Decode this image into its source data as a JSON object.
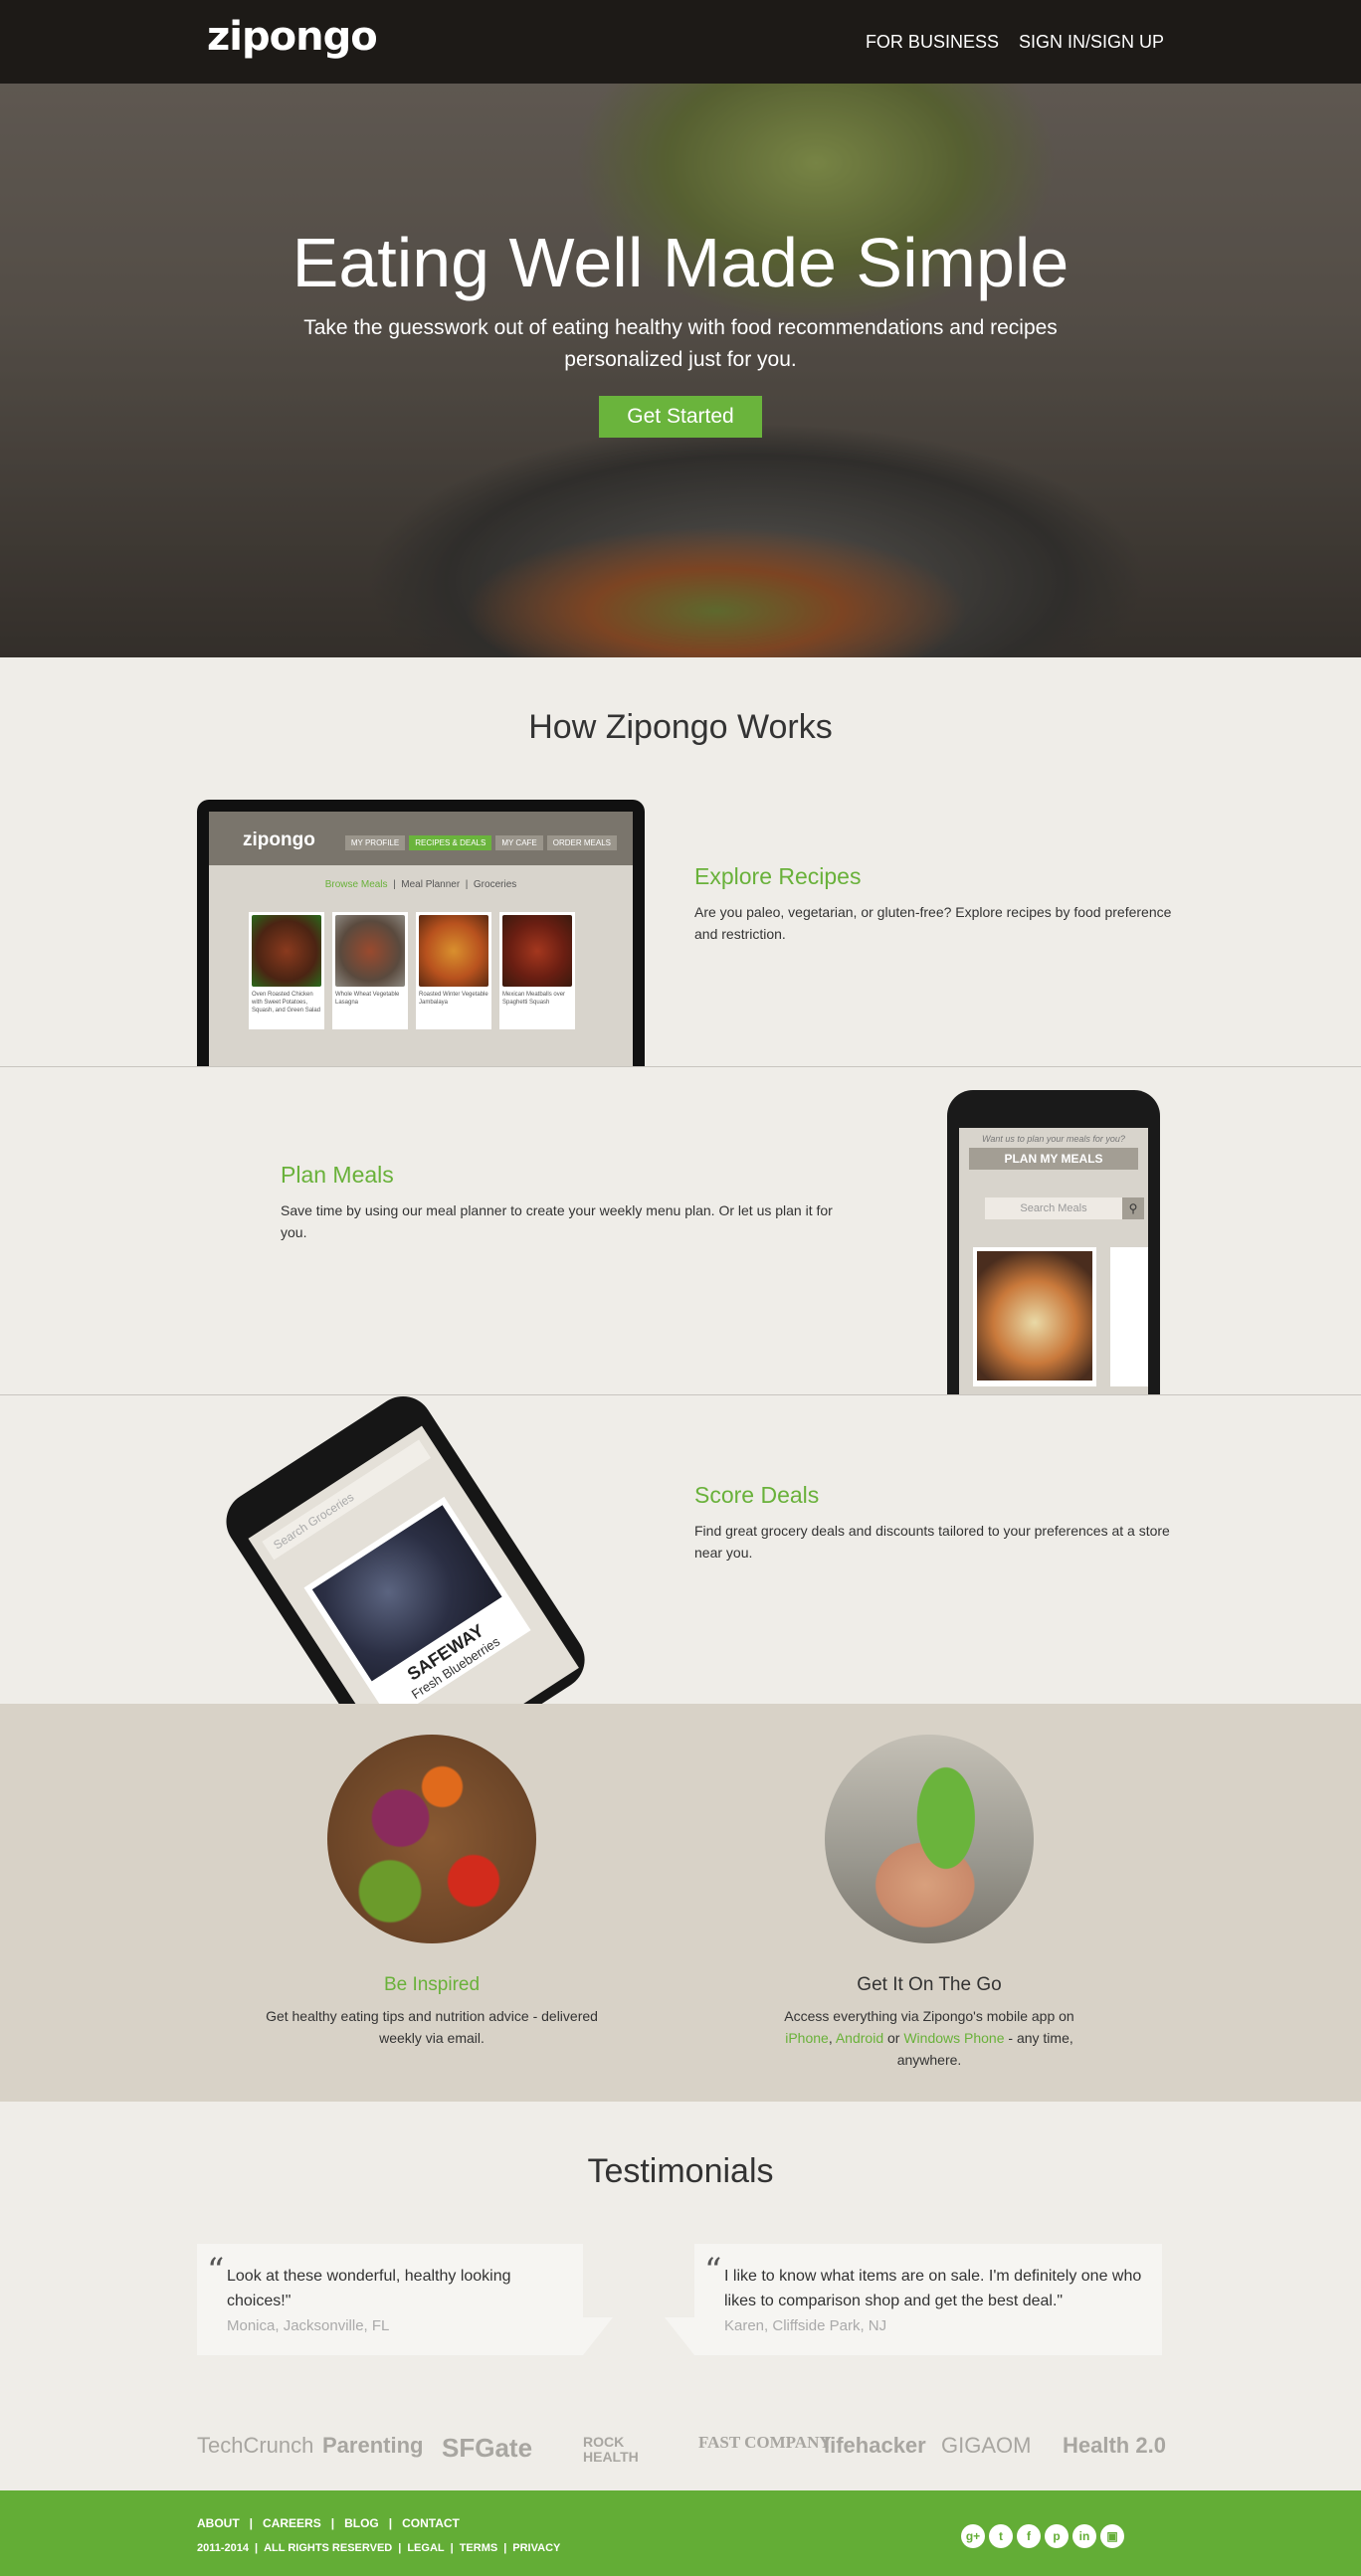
{
  "header": {
    "logo": "zipongo",
    "nav": [
      "FOR BUSINESS",
      "SIGN IN/SIGN UP"
    ]
  },
  "hero": {
    "title": "Eating Well Made Simple",
    "subtitle": "Take the guesswork out of eating healthy with food recommendations and recipes personalized just for you.",
    "cta": "Get Started"
  },
  "how": {
    "title": "How Zipongo Works",
    "features": [
      {
        "title": "Explore Recipes",
        "text": "Are you paleo, vegetarian, or gluten-free? Explore recipes by food preference and restriction."
      },
      {
        "title": "Plan Meals",
        "text": "Save time by using our meal planner to create your weekly menu plan. Or let us plan it for you."
      },
      {
        "title": "Score Deals",
        "text": "Find great grocery deals and discounts tailored to your preferences at a store near you."
      }
    ]
  },
  "laptop": {
    "logo": "zipongo",
    "tabs": [
      "MY PROFILE",
      "RECIPES & DEALS",
      "MY CAFE",
      "ORDER MEALS"
    ],
    "subnav": [
      "Browse Meals",
      "Meal Planner",
      "Groceries"
    ],
    "cards": [
      "Oven Roasted Chicken with Sweet Potatoes, Squash, and Green Salad",
      "Whole Wheat Vegetable Lasagna",
      "Roasted Winter Vegetable Jambalaya",
      "Mexican Meatballs over Spaghetti Squash"
    ]
  },
  "phone": {
    "prompt": "Want us to plan your meals for you?",
    "button": "PLAN MY MEALS",
    "search": "Search Meals"
  },
  "tphone": {
    "search": "Search Groceries",
    "store": "SAFEWAY",
    "item": "Fresh Blueberries"
  },
  "band": {
    "left": {
      "title": "Be Inspired",
      "text": "Get healthy eating tips and nutrition advice - delivered weekly via email."
    },
    "right": {
      "title": "Get It On The Go",
      "pre": "Access everything via Zipongo's mobile app on",
      "iphone": "iPhone",
      "android": "Android",
      "or": "or",
      "wp": "Windows Phone",
      "post": "- any time, anywhere."
    }
  },
  "testimonials": {
    "title": "Testimonials",
    "items": [
      {
        "quote": "Look at these wonderful, healthy looking choices!\"",
        "author": "Monica, Jacksonville, FL"
      },
      {
        "quote": "I like to know what items are on sale. I'm definitely one who likes to comparison shop and get the best deal.\"",
        "author": "Karen, Cliffside Park, NJ"
      }
    ]
  },
  "press": [
    "TechCrunch",
    "Parenting",
    "SFGate",
    "ROCK HEALTH",
    "FAST COMPANY",
    "lifehacker",
    "GIGAOM",
    "Health 2.0"
  ],
  "footer": {
    "links": [
      "ABOUT",
      "CAREERS",
      "BLOG",
      "CONTACT"
    ],
    "copyright": "2011-2014",
    "rights": "ALL RIGHTS RESERVED",
    "legal": [
      "LEGAL",
      "TERMS",
      "PRIVACY"
    ],
    "social": [
      "google-plus-icon",
      "twitter-icon",
      "facebook-icon",
      "pinterest-icon",
      "linkedin-icon",
      "instagram-icon"
    ]
  },
  "colors": {
    "brand_green": "#6ab43c",
    "header_bg": "#1d1a17",
    "footer_bg": "#63ad36"
  }
}
